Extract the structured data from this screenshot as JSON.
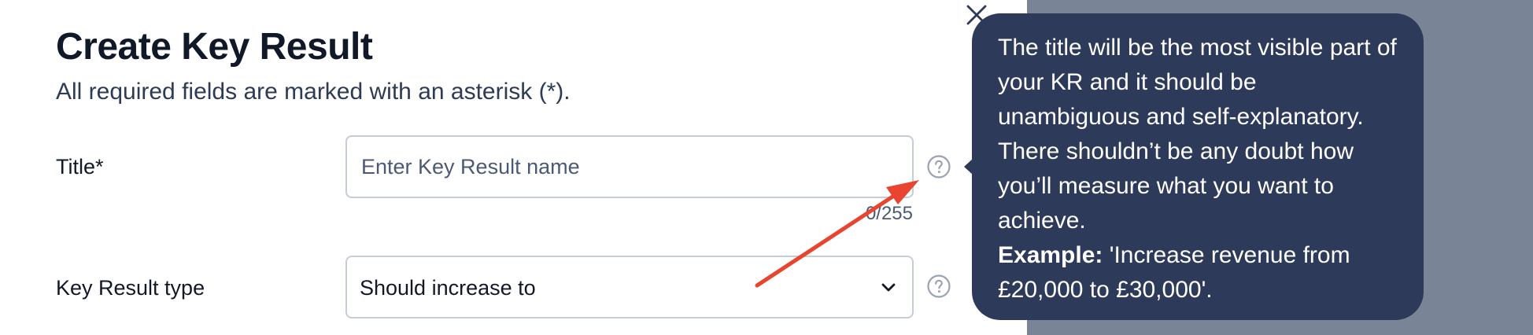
{
  "dialog": {
    "title": "Create Key Result",
    "subtitle": "All required fields are marked with an asterisk (*).",
    "close_icon": "close-icon"
  },
  "fields": {
    "title": {
      "label": "Title*",
      "placeholder": "Enter Key Result name",
      "value": "",
      "counter": "0/255",
      "help_icon": "question-circle-icon"
    },
    "key_result_type": {
      "label": "Key Result type",
      "selected": "Should increase to",
      "help_icon": "question-circle-icon"
    }
  },
  "tooltip": {
    "text": "The title will be the most visible part of your KR and it should be unambiguous and self-explanatory. There shouldn’t be any doubt how you’ll measure what you want to achieve.",
    "example_label": "Example:",
    "example_text": " 'Increase revenue from £20,000 to £30,000'."
  },
  "colors": {
    "tooltip_bg": "#2e3a59",
    "backdrop": "#7a8497",
    "annotation_arrow": "#e8442f",
    "text_dark": "#111827",
    "text_muted": "#4b5a74"
  }
}
